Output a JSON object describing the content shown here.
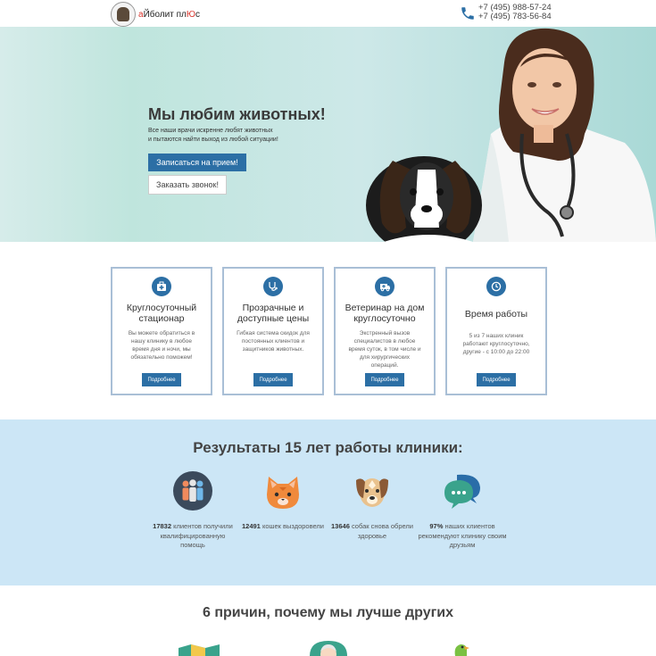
{
  "header": {
    "logo_text_a": "а",
    "logo_text_b": "Йболит пл",
    "logo_text_c": "Ю",
    "logo_text_d": "с",
    "phones": [
      "+7 (495) 988-57-24",
      "+7 (495) 783-56-84"
    ]
  },
  "hero": {
    "title": "Мы любим животных!",
    "subtitle_line1": "Все наши врачи искренне любят животных",
    "subtitle_line2": "и пытаются найти выход из любой ситуации!",
    "primary_button": "Записаться на прием!",
    "secondary_button": "Заказать звонок!"
  },
  "cards": [
    {
      "title": "Круглосуточный стационар",
      "text": "Вы можете обратиться в нашу клинику в любое время дня и ночи, мы обязательно поможем!",
      "button": "Подробнее",
      "icon": "first-aid-kit-icon"
    },
    {
      "title": "Прозрачные и доступные цены",
      "text": "Гибкая система скидок для постоянных клиентов и защитников животных.",
      "button": "Подробнее",
      "icon": "stethoscope-icon"
    },
    {
      "title": "Ветеринар на дом круглосуточно",
      "text": "Экстренный вызов специалистов в любое время суток, в том числе и для хирургических операций.",
      "button": "Подробнее",
      "icon": "ambulance-icon"
    },
    {
      "title": "Время работы",
      "text": "5 из 7 наших клиник работают круглосуточно, другие - с 10:00 до 22:00",
      "button": "Подробнее",
      "icon": "clock-icon"
    }
  ],
  "results": {
    "title": "Результаты 15 лет работы клиники:",
    "stats": [
      {
        "number": "17832",
        "text": "клиентов получили квалифицированную помощь",
        "icon": "people-icon"
      },
      {
        "number": "12491",
        "text": "кошек выздоровели",
        "icon": "cat-icon"
      },
      {
        "number": "13646",
        "text": "собак снова обрели здоровье",
        "icon": "dog-icon"
      },
      {
        "number": "97%",
        "text": "наших клиентов рекомендуют клинику своим друзьям",
        "icon": "chat-bubbles-icon"
      }
    ]
  },
  "reasons": {
    "title": "6 причин, почему мы лучше других"
  },
  "colors": {
    "accent": "#2c6fa5",
    "results_bg": "#cce6f6",
    "card_border": "#a9bfd6"
  }
}
